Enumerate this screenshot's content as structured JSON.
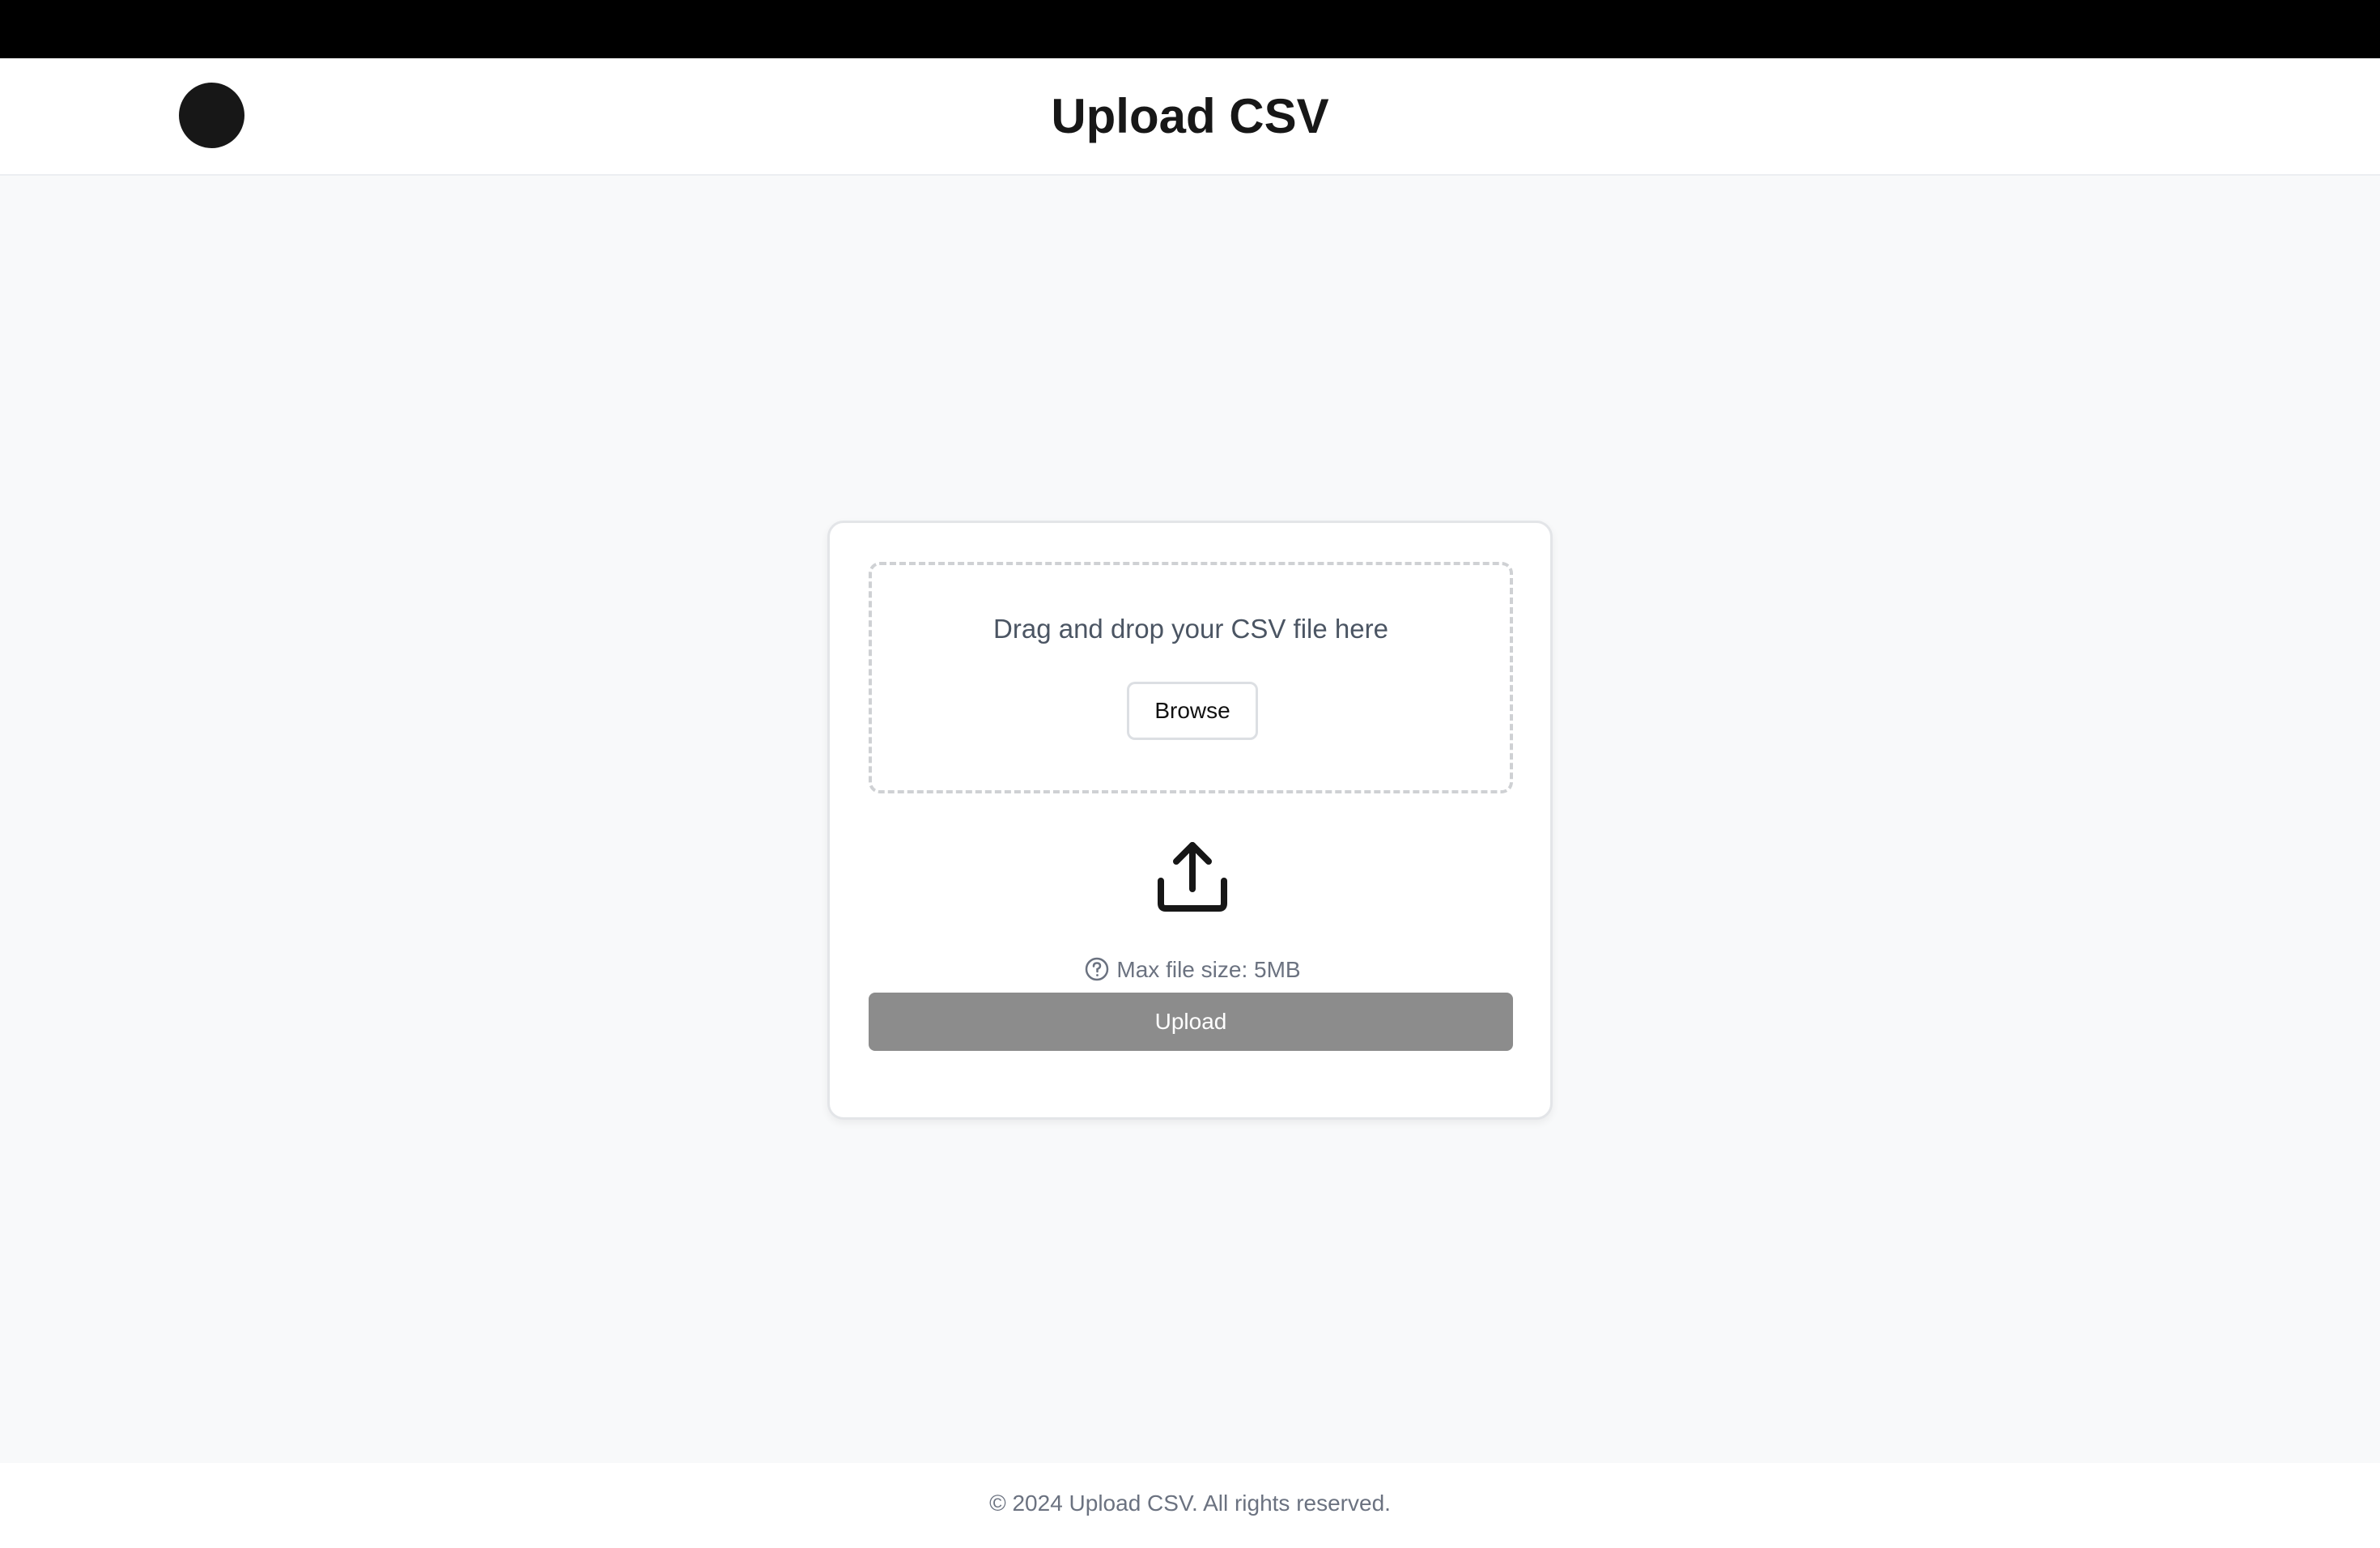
{
  "header": {
    "title": "Upload CSV",
    "logo_icon": "circle-logo"
  },
  "upload_card": {
    "drop_text": "Drag and drop your CSV file here",
    "browse_label": "Browse",
    "upload_icon": "upload-tray-icon",
    "help_icon": "question-circle-icon",
    "max_size_text": "Max file size: 5MB",
    "upload_label": "Upload",
    "upload_enabled": false
  },
  "footer": {
    "text": "© 2024 Upload CSV. All rights reserved."
  },
  "colors": {
    "topbar": "#000000",
    "logo": "#171717",
    "page_background": "#f8f9fa",
    "upload_button_disabled": "#8c8c8c",
    "muted_text": "#6b7280"
  }
}
